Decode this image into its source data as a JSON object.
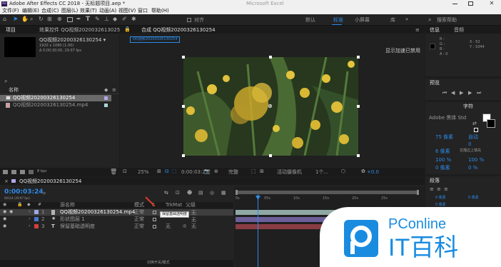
{
  "window": {
    "title": "Adobe After Effects CC 2018 - 无标题项目.aep *",
    "tab_hint": "Microsoft Excel"
  },
  "menu": [
    "文件(F)",
    "编辑(E)",
    "合成(C)",
    "图层(L)",
    "效果(T)",
    "动画(A)",
    "视图(V)",
    "窗口",
    "帮助(H)"
  ],
  "toolbar": {
    "align_label": "对齐",
    "workspaces": [
      "默认",
      "标准",
      "小屏幕",
      "库"
    ],
    "search_placeholder": "搜索帮助"
  },
  "project": {
    "tab": "项目",
    "effects_tab": "效果控件 QQ视频20200326130254",
    "item_name": "QQ视频20200326130254 ▾",
    "item_info1": "1920 x 1080 (1.00)",
    "item_info2": "Δ 0;00;30;00, 29.97 fps",
    "col_name": "名称",
    "rows": [
      "QQ视频20200326130254",
      "QQ视频20200326130254.mp4"
    ],
    "bpc": "8 bpc"
  },
  "composition": {
    "tab": "合成 QQ视频20200326130254",
    "breadcrumb": "QQ视频20200326130254",
    "gpu_note": "显示加速已禁用",
    "zoom": "25%",
    "timecode": "0:00:03:24",
    "quality": "完整",
    "camera": "活动摄像机",
    "views": "1个...",
    "exposure": "+0.0"
  },
  "info": {
    "tab": "信息",
    "audio_tab": "音频",
    "r": "R :",
    "g": "G :",
    "b": "B :",
    "a": "A : 0",
    "x": "X : 52",
    "y": "Y : 1044"
  },
  "preview": {
    "tab": "预览"
  },
  "character": {
    "tab": "字符",
    "font": "Adobe 黑体 Std",
    "size": "75 像素",
    "leading": "自动",
    "tracking": "0",
    "stroke": "6 像素",
    "fill": "在描边上填充",
    "scale_v": "100 %",
    "scale_h": "100 %",
    "baseline": "0 像素",
    "tsume": "0 %"
  },
  "paragraph": {
    "tab": "段落",
    "vals": [
      "0 像素",
      "0 像素",
      "0 像素",
      "0 像素",
      "0 像素"
    ]
  },
  "timeline": {
    "tab": "QQ视频20200326130254",
    "timecode": "0:00:03:24",
    "timecode_sub": "00114 (29.97 fps)",
    "columns": {
      "mode": "模式",
      "t": "T",
      "trkmat": "TrkMat",
      "parent": "父级",
      "name": "源名称"
    },
    "layers": [
      {
        "num": "1",
        "name": "QQ视频20200326130254.mp4",
        "mode": "正常",
        "parent": "无",
        "color": "#9aa8e0"
      },
      {
        "num": "2",
        "name": "形状图层 1",
        "mode": "正常",
        "parent": "无",
        "color": "#4a74d0"
      },
      {
        "num": "3",
        "name": "保留基础透明度",
        "mode": "正常",
        "parent": "无",
        "color": "#d04040"
      }
    ],
    "tooltip": "保留基础透明度",
    "toggle_label": "切换开关/模式",
    "ruler": [
      "0s",
      "05s",
      "10s",
      "15s",
      "20s",
      "25s"
    ]
  },
  "watermark": {
    "brand": "PConline",
    "name": "IT百科"
  }
}
